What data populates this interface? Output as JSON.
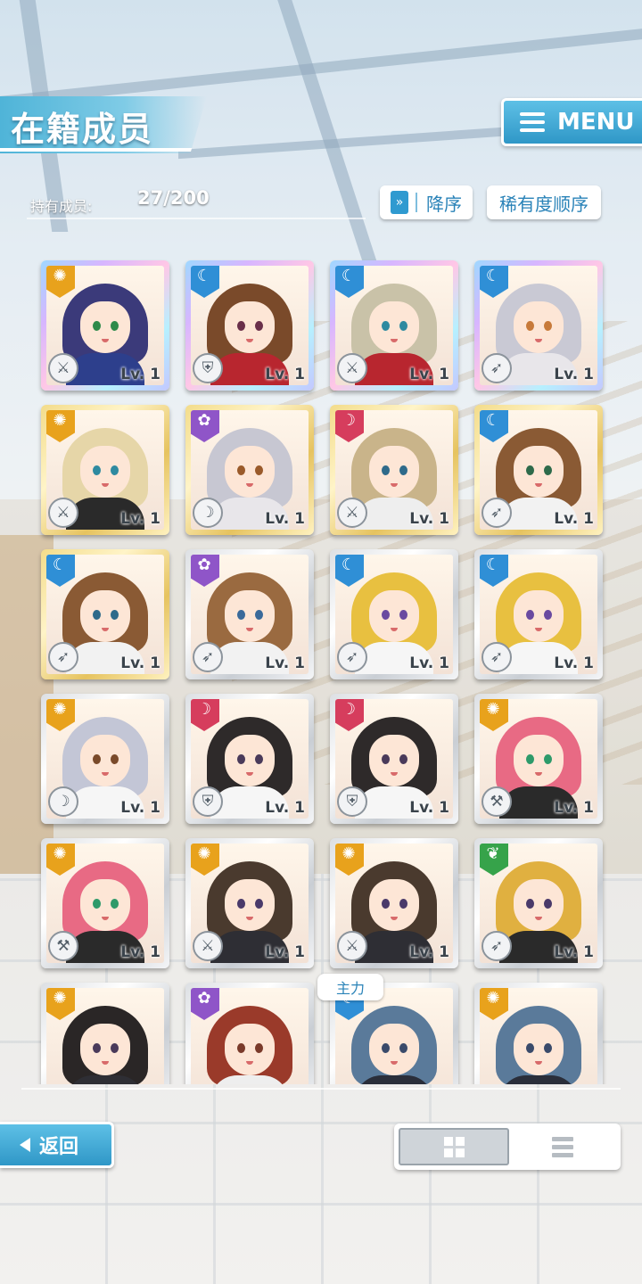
{
  "header": {
    "title": "在籍成员",
    "menu_label": "MENU"
  },
  "members": {
    "count_label": "持有成员:",
    "count_value": "27/200"
  },
  "sort": {
    "order_label": "降序",
    "order_icon": "double-chevron-down-icon",
    "rarity_label": "稀有度顺序"
  },
  "attribute_colors": {
    "sun": "#e8a21c",
    "moon": "#2f8fd6",
    "star": "#8f55c8",
    "heart": "#d63d5d",
    "leaf": "#36a34a"
  },
  "cards": [
    {
      "rarity": "rainbow",
      "attribute": "sun",
      "role": "sword",
      "level": "Lv. 1",
      "hair": "#3b3a7a",
      "eyes": "#2e8a4a",
      "outfit": "#2d3f8c"
    },
    {
      "rarity": "rainbow",
      "attribute": "moon",
      "role": "shield",
      "level": "Lv. 1",
      "hair": "#7a4a2a",
      "eyes": "#6a2f4a",
      "outfit": "#b8262f"
    },
    {
      "rarity": "rainbow",
      "attribute": "moon",
      "role": "sword",
      "level": "Lv. 1",
      "hair": "#c9c2a8",
      "eyes": "#2e8aa0",
      "outfit": "#b8262f"
    },
    {
      "rarity": "rainbow",
      "attribute": "moon",
      "role": "lance",
      "level": "Lv. 1",
      "hair": "#c9c9d4",
      "eyes": "#c77a3a",
      "outfit": "#e8e6ea"
    },
    {
      "rarity": "gold",
      "attribute": "sun",
      "role": "sword",
      "level": "Lv. 1",
      "hair": "#e6d6a8",
      "eyes": "#2e8aa0",
      "outfit": "#2a2a2a"
    },
    {
      "rarity": "gold",
      "attribute": "star",
      "role": "bow",
      "level": "Lv. 1",
      "hair": "#c7c7d2",
      "eyes": "#9a5a2a",
      "outfit": "#e8e6ea"
    },
    {
      "rarity": "gold",
      "attribute": "heart",
      "role": "sword",
      "level": "Lv. 1",
      "hair": "#c9b48a",
      "eyes": "#2e6a8a",
      "outfit": "#eeeeee"
    },
    {
      "rarity": "gold",
      "attribute": "moon",
      "role": "lance",
      "level": "Lv. 1",
      "hair": "#8a5a34",
      "eyes": "#2e6a4a",
      "outfit": "#f2f2f2"
    },
    {
      "rarity": "gold",
      "attribute": "moon",
      "role": "lance",
      "level": "Lv. 1",
      "hair": "#8a5a34",
      "eyes": "#2e6a8a",
      "outfit": "#f2f2f2"
    },
    {
      "rarity": "silver",
      "attribute": "star",
      "role": "lance",
      "level": "Lv. 1",
      "hair": "#9a6a40",
      "eyes": "#3a6a9a",
      "outfit": "#f2f2f2"
    },
    {
      "rarity": "silver",
      "attribute": "moon",
      "role": "lance",
      "level": "Lv. 1",
      "hair": "#e8c040",
      "eyes": "#6a4aa0",
      "outfit": "#f6f6f6"
    },
    {
      "rarity": "silver",
      "attribute": "moon",
      "role": "lance",
      "level": "Lv. 1",
      "hair": "#e8c040",
      "eyes": "#6a4aa0",
      "outfit": "#f6f6f6"
    },
    {
      "rarity": "silver",
      "attribute": "sun",
      "role": "bow",
      "level": "Lv. 1",
      "hair": "#c3c6d6",
      "eyes": "#7a4a2a",
      "outfit": "#f6f6f6"
    },
    {
      "rarity": "silver",
      "attribute": "heart",
      "role": "shield",
      "level": "Lv. 1",
      "hair": "#2e2a2a",
      "eyes": "#4a3a5a",
      "outfit": "#f6f6f6"
    },
    {
      "rarity": "silver",
      "attribute": "heart",
      "role": "shield",
      "level": "Lv. 1",
      "hair": "#2e2a2a",
      "eyes": "#4a3a5a",
      "outfit": "#f6f6f6"
    },
    {
      "rarity": "silver",
      "attribute": "sun",
      "role": "hammer",
      "level": "Lv. 1",
      "hair": "#e86a84",
      "eyes": "#2e9a6a",
      "outfit": "#2a2a2a"
    },
    {
      "rarity": "silver",
      "attribute": "sun",
      "role": "hammer",
      "level": "Lv. 1",
      "hair": "#e86a84",
      "eyes": "#2e9a6a",
      "outfit": "#2a2a2a"
    },
    {
      "rarity": "silver",
      "attribute": "sun",
      "role": "sword",
      "level": "Lv. 1",
      "hair": "#4a3a2e",
      "eyes": "#4a3a6a",
      "outfit": "#2e2e34"
    },
    {
      "rarity": "silver",
      "attribute": "sun",
      "role": "sword",
      "level": "Lv. 1",
      "hair": "#4a3a2e",
      "eyes": "#4a3a6a",
      "outfit": "#2e2e34"
    },
    {
      "rarity": "silver",
      "attribute": "leaf",
      "role": "lance",
      "level": "Lv. 1",
      "hair": "#e0b040",
      "eyes": "#4a3a6a",
      "outfit": "#2a2a2a"
    },
    {
      "rarity": "silver",
      "attribute": "sun",
      "role": "",
      "level": "",
      "hair": "#2a2626",
      "eyes": "#4a3a5a",
      "outfit": "#2e2e34"
    },
    {
      "rarity": "silver",
      "attribute": "star",
      "role": "",
      "level": "",
      "hair": "#9a3a2a",
      "eyes": "#7a3a2a",
      "outfit": "#eeeeee"
    },
    {
      "rarity": "silver",
      "attribute": "moon",
      "role": "",
      "level": "",
      "hair": "#5a7a9a",
      "eyes": "#3a4a6a",
      "outfit": "#2a2e3a"
    },
    {
      "rarity": "silver",
      "attribute": "sun",
      "role": "",
      "level": "",
      "hair": "#5a7a9a",
      "eyes": "#3a4a6a",
      "outfit": "#2a2e3a"
    }
  ],
  "main_badge": "主力",
  "footer": {
    "back_label": "返回",
    "view_options": [
      "grid-view-icon",
      "list-view-icon"
    ],
    "active_view": "grid"
  }
}
